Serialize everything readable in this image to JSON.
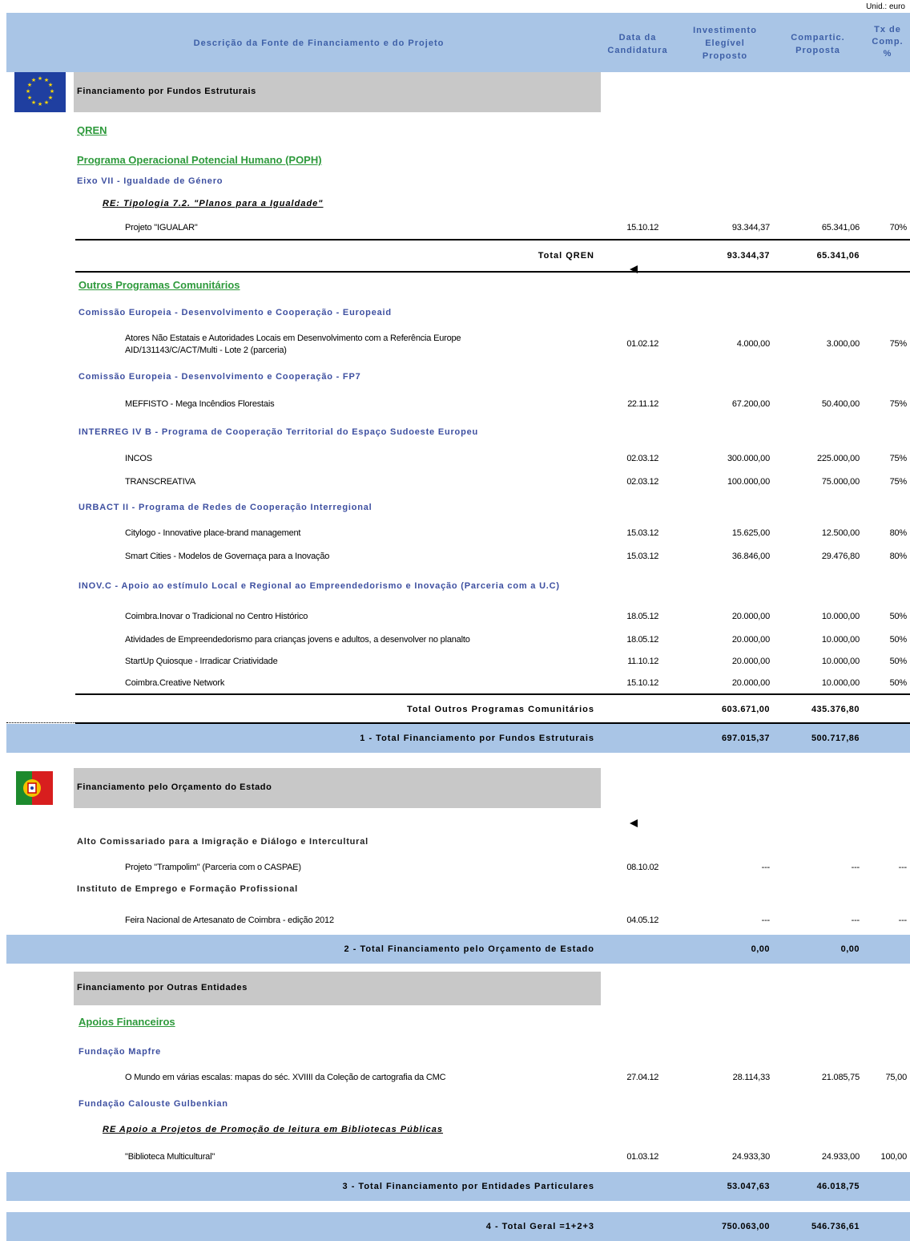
{
  "unit": "Unid.: euro",
  "header": {
    "description": "Descrição da Fonte de Financiamento e do Projeto",
    "date_line1": "Data da",
    "date_line2": "Candidatura",
    "inv_line1": "Investimento",
    "inv_line2": "Elegível",
    "inv_line3": "Proposto",
    "comp_line1": "Compartic.",
    "comp_line2": "Proposta",
    "tx_line1": "Tx de",
    "tx_line2": "Comp.",
    "tx_line3": "%"
  },
  "structural": {
    "title": "Financiamento por Fundos Estruturais",
    "qren": "QREN",
    "poph": "Programa Operacional Potencial Humano (POPH)",
    "eixo": "Eixo VII - Igualdade de Género",
    "re": "RE: Tipologia 7.2. \"Planos para a Igualdade\"",
    "item": {
      "name": "Projeto \"IGUALAR\"",
      "date": "15.10.12",
      "inv": "93.344,37",
      "comp": "65.341,06",
      "tx": "70%"
    },
    "total_qren": {
      "label": "Total QREN",
      "inv": "93.344,37",
      "comp": "65.341,06"
    },
    "outros_title": "Outros Programas Comunitários",
    "europeaid": "Comissão Europeia - Desenvolvimento e Cooperação - Europeaid",
    "atores": {
      "name1": "Atores Não Estatais e Autoridades Locais em Desenvolvimento com a Referência Europe",
      "name2": "AID/131143/C/ACT/Multi - Lote 2 (parceria)",
      "date": "01.02.12",
      "inv": "4.000,00",
      "comp": "3.000,00",
      "tx": "75%"
    },
    "fp7": "Comissão Europeia - Desenvolvimento e Cooperação - FP7",
    "meffisto": {
      "name": "MEFFISTO - Mega Incêndios Florestais",
      "date": "22.11.12",
      "inv": "67.200,00",
      "comp": "50.400,00",
      "tx": "75%"
    },
    "interreg": "INTERREG IV B - Programa de Cooperação Territorial do Espaço Sudoeste Europeu",
    "incos": {
      "name": "INCOS",
      "date": "02.03.12",
      "inv": "300.000,00",
      "comp": "225.000,00",
      "tx": "75%"
    },
    "transcreativa": {
      "name": "TRANSCREATIVA",
      "date": "02.03.12",
      "inv": "100.000,00",
      "comp": "75.000,00",
      "tx": "75%"
    },
    "urbact": "URBACT II - Programa de Redes de Cooperação Interregional",
    "citylogo": {
      "name": "Citylogo - Innovative place-brand management",
      "date": "15.03.12",
      "inv": "15.625,00",
      "comp": "12.500,00",
      "tx": "80%"
    },
    "smart": {
      "name": "Smart Cities - Modelos de Governaça para a Inovação",
      "date": "15.03.12",
      "inv": "36.846,00",
      "comp": "29.476,80",
      "tx": "80%"
    },
    "inov": "INOV.C - Apoio ao estímulo Local e Regional ao Empreendedorismo e Inovação (Parceria com a U.C)",
    "inov_items": [
      {
        "name": "Coimbra.Inovar o Tradicional no Centro Histórico",
        "date": "18.05.12",
        "inv": "20.000,00",
        "comp": "10.000,00",
        "tx": "50%"
      },
      {
        "name": "Atividades de Empreendedorismo para crianças jovens e adultos, a desenvolver no planalto",
        "date": "18.05.12",
        "inv": "20.000,00",
        "comp": "10.000,00",
        "tx": "50%"
      },
      {
        "name": "StartUp Quiosque - Irradicar Criatividade",
        "date": "11.10.12",
        "inv": "20.000,00",
        "comp": "10.000,00",
        "tx": "50%"
      },
      {
        "name": "Coimbra.Creative Network",
        "date": "15.10.12",
        "inv": "20.000,00",
        "comp": "10.000,00",
        "tx": "50%"
      }
    ],
    "total_outros": {
      "label": "Total Outros Programas Comunitários",
      "inv": "603.671,00",
      "comp": "435.376,80"
    },
    "total1": {
      "label": "1 - Total Financiamento por Fundos Estruturais",
      "inv": "697.015,37",
      "comp": "500.717,86"
    }
  },
  "estado": {
    "title": "Financiamento pelo Orçamento do Estado",
    "acidi": "Alto Comissariado para a Imigração e Diálogo e Intercultural",
    "trampolim": {
      "name": "Projeto \"Trampolim\" (Parceria com o CASPAE)",
      "date": "08.10.02",
      "inv": "---",
      "comp": "---",
      "tx": "---"
    },
    "iefp": "Instituto de Emprego e Formação Profissional",
    "feira": {
      "name": "Feira Nacional de Artesanato de Coimbra - edição 2012",
      "date": "04.05.12",
      "inv": "---",
      "comp": "---",
      "tx": "---"
    },
    "total2": {
      "label": "2 - Total Financiamento pelo Orçamento de Estado",
      "inv": "0,00",
      "comp": "0,00"
    }
  },
  "outras": {
    "title": "Financiamento por Outras Entidades",
    "apoios": "Apoios Financeiros",
    "mapfre": "Fundação Mapfre",
    "mundo": {
      "name": "O Mundo em várias escalas: mapas do séc. XVIIII da Coleção de cartografia da CMC",
      "date": "27.04.12",
      "inv": "28.114,33",
      "comp": "21.085,75",
      "tx": "75,00"
    },
    "gulbenkian": "Fundação Calouste Gulbenkian",
    "re": "RE Apoio a Projetos de Promoção de leitura em Bibliotecas Públicas",
    "biblioteca": {
      "name": "\"Biblioteca Multicultural\"",
      "date": "01.03.12",
      "inv": "24.933,30",
      "comp": "24.933,00",
      "tx": "100,00"
    },
    "total3": {
      "label": "3 - Total Financiamento por Entidades Particulares",
      "inv": "53.047,63",
      "comp": "46.018,75"
    },
    "total4": {
      "label": "4 - Total Geral =1+2+3",
      "inv": "750.063,00",
      "comp": "546.736,61"
    }
  }
}
